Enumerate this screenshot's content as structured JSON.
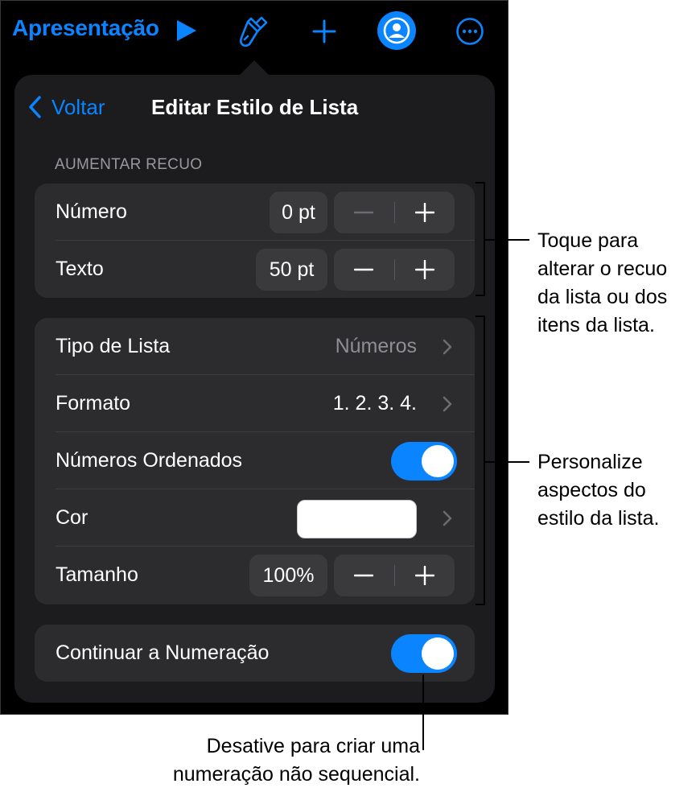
{
  "toolbar": {
    "title": "Apresentação",
    "icons": [
      "play-icon",
      "paintbrush-icon",
      "plus-icon",
      "collaborate-icon",
      "more-icon"
    ]
  },
  "panel": {
    "back_label": "Voltar",
    "title": "Editar Estilo de Lista",
    "section_label": "AUMENTAR RECUO",
    "indent": {
      "numero": {
        "label": "Número",
        "value": "0 pt"
      },
      "texto": {
        "label": "Texto",
        "value": "50 pt"
      }
    },
    "style": {
      "tipo": {
        "label": "Tipo de Lista",
        "value": "Números"
      },
      "formato": {
        "label": "Formato",
        "value": "1. 2. 3. 4."
      },
      "ordenados": {
        "label": "Números Ordenados",
        "on": true
      },
      "cor": {
        "label": "Cor",
        "color": "#ffffff"
      },
      "tamanho": {
        "label": "Tamanho",
        "value": "100%"
      }
    },
    "continuar": {
      "label": "Continuar a Numeração",
      "on": true
    }
  },
  "callouts": {
    "recuo": [
      "Toque para",
      "alterar o recuo",
      "da lista ou dos",
      "itens da lista."
    ],
    "estilo": [
      "Personalize",
      "aspectos do",
      "estilo da lista."
    ],
    "numeracao": [
      "Desative para criar uma",
      "numeração não sequencial."
    ]
  },
  "colors": {
    "accent": "#0a84ff",
    "panel": "#1c1c1e",
    "group": "#2c2c2e"
  }
}
